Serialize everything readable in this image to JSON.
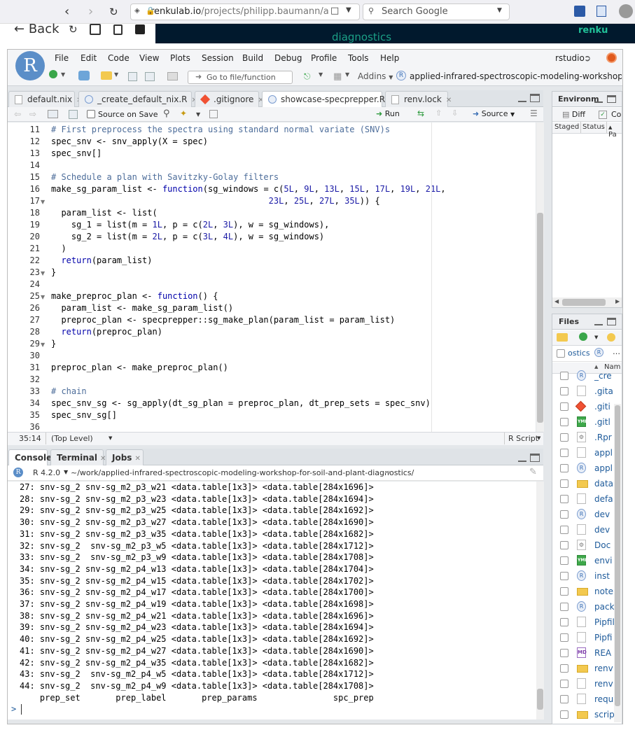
{
  "browser": {
    "url_host": "renkulab.io",
    "url_path": "/projects/philipp.baumann/a",
    "search_placeholder": "Search Google"
  },
  "renku": {
    "back_label": "Back",
    "title": "diagnostics",
    "logo": "renku"
  },
  "rstudio": {
    "menu": [
      "File",
      "Edit",
      "Code",
      "View",
      "Plots",
      "Session",
      "Build",
      "Debug",
      "Profile",
      "Tools",
      "Help"
    ],
    "user": "rstudio",
    "goto_placeholder": "Go to file/function",
    "addins_label": "Addins",
    "project_label": "applied-infrared-spectroscopic-modeling-workshop-for-soil-an"
  },
  "source": {
    "tabs": [
      {
        "label": "default.nix"
      },
      {
        "label": "_create_default_nix.R"
      },
      {
        "label": ".gitignore"
      },
      {
        "label": "showcase-specprepper.R"
      },
      {
        "label": "renv.lock"
      }
    ],
    "source_on_save": "Source on Save",
    "run_label": "Run",
    "source_label": "Source",
    "lines": [
      {
        "n": "11",
        "t": "# First preprocess the spectra using standard normal variate (SNV)s"
      },
      {
        "n": "12",
        "t": "spec_snv <- snv_apply(X = spec)"
      },
      {
        "n": "13",
        "t": "spec_snv[]"
      },
      {
        "n": "14",
        "t": ""
      },
      {
        "n": "15",
        "t": "# Schedule a plan with Savitzky-Golay filters"
      },
      {
        "n": "16",
        "t": "make_sg_param_list <- function(sg_windows = c(5L, 9L, 13L, 15L, 17L, 19L, 21L,"
      },
      {
        "n": "17",
        "t": "                                           23L, 25L, 27L, 35L)) {"
      },
      {
        "n": "18",
        "t": "  param_list <- list("
      },
      {
        "n": "19",
        "t": "    sg_1 = list(m = 1L, p = c(2L, 3L), w = sg_windows),"
      },
      {
        "n": "20",
        "t": "    sg_2 = list(m = 2L, p = c(3L, 4L), w = sg_windows)"
      },
      {
        "n": "21",
        "t": "  )"
      },
      {
        "n": "22",
        "t": "  return(param_list)"
      },
      {
        "n": "23",
        "t": "}"
      },
      {
        "n": "24",
        "t": ""
      },
      {
        "n": "25",
        "t": "make_preproc_plan <- function() {"
      },
      {
        "n": "26",
        "t": "  param_list <- make_sg_param_list()"
      },
      {
        "n": "27",
        "t": "  preproc_plan <- specprepper::sg_make_plan(param_list = param_list)"
      },
      {
        "n": "28",
        "t": "  return(preproc_plan)"
      },
      {
        "n": "29",
        "t": "}"
      },
      {
        "n": "30",
        "t": ""
      },
      {
        "n": "31",
        "t": "preproc_plan <- make_preproc_plan()"
      },
      {
        "n": "32",
        "t": ""
      },
      {
        "n": "33",
        "t": "# chain"
      },
      {
        "n": "34",
        "t": "spec_snv_sg <- sg_apply(dt_sg_plan = preproc_plan, dt_prep_sets = spec_snv)"
      },
      {
        "n": "35",
        "t": "spec_snv_sg[]"
      },
      {
        "n": "36",
        "t": ""
      }
    ],
    "cursor_pos": "35:14",
    "scope": "(Top Level)",
    "file_type": "R Script"
  },
  "console": {
    "tabs": [
      "Console",
      "Terminal",
      "Jobs"
    ],
    "r_version": "R 4.2.0",
    "path": "~/work/applied-infrared-spectroscopic-modeling-workshop-for-soil-and-plant-diagnostics/",
    "lines": [
      "27: snv-sg_2 snv-sg_m2_p3_w21 <data.table[1x3]> <data.table[284x1696]>",
      "28: snv-sg_2 snv-sg_m2_p3_w23 <data.table[1x3]> <data.table[284x1694]>",
      "29: snv-sg_2 snv-sg_m2_p3_w25 <data.table[1x3]> <data.table[284x1692]>",
      "30: snv-sg_2 snv-sg_m2_p3_w27 <data.table[1x3]> <data.table[284x1690]>",
      "31: snv-sg_2 snv-sg_m2_p3_w35 <data.table[1x3]> <data.table[284x1682]>",
      "32: snv-sg_2  snv-sg_m2_p3_w5 <data.table[1x3]> <data.table[284x1712]>",
      "33: snv-sg_2  snv-sg_m2_p3_w9 <data.table[1x3]> <data.table[284x1708]>",
      "34: snv-sg_2 snv-sg_m2_p4_w13 <data.table[1x3]> <data.table[284x1704]>",
      "35: snv-sg_2 snv-sg_m2_p4_w15 <data.table[1x3]> <data.table[284x1702]>",
      "36: snv-sg_2 snv-sg_m2_p4_w17 <data.table[1x3]> <data.table[284x1700]>",
      "37: snv-sg_2 snv-sg_m2_p4_w19 <data.table[1x3]> <data.table[284x1698]>",
      "38: snv-sg_2 snv-sg_m2_p4_w21 <data.table[1x3]> <data.table[284x1696]>",
      "39: snv-sg_2 snv-sg_m2_p4_w23 <data.table[1x3]> <data.table[284x1694]>",
      "40: snv-sg_2 snv-sg_m2_p4_w25 <data.table[1x3]> <data.table[284x1692]>",
      "41: snv-sg_2 snv-sg_m2_p4_w27 <data.table[1x3]> <data.table[284x1690]>",
      "42: snv-sg_2 snv-sg_m2_p4_w35 <data.table[1x3]> <data.table[284x1682]>",
      "43: snv-sg_2  snv-sg_m2_p4_w5 <data.table[1x3]> <data.table[284x1712]>",
      "44: snv-sg_2  snv-sg_m2_p4_w9 <data.table[1x3]> <data.table[284x1708]>",
      "    prep_set       prep_label       prep_params               spc_prep"
    ],
    "prompt": ">"
  },
  "env": {
    "title": "Environm",
    "diff_label": "Diff",
    "commit_label": "Co",
    "col_staged": "Staged",
    "col_status": "Status",
    "col_path": "Pa"
  },
  "files": {
    "title": "Files",
    "breadcrumb": "ostics",
    "col_name": "Nam",
    "items": [
      {
        "name": "_cre",
        "icon": "r"
      },
      {
        "name": ".gita",
        "icon": "file"
      },
      {
        "name": ".giti",
        "icon": "git"
      },
      {
        "name": ".gitl",
        "icon": "yml"
      },
      {
        "name": ".Rpr",
        "icon": "gear"
      },
      {
        "name": "appl",
        "icon": "file"
      },
      {
        "name": "appl",
        "icon": "r"
      },
      {
        "name": "data",
        "icon": "folder"
      },
      {
        "name": "defa",
        "icon": "file"
      },
      {
        "name": "dev",
        "icon": "r"
      },
      {
        "name": "dev",
        "icon": "file"
      },
      {
        "name": "Doc",
        "icon": "gear"
      },
      {
        "name": "envi",
        "icon": "yml"
      },
      {
        "name": "inst",
        "icon": "r"
      },
      {
        "name": "note",
        "icon": "folder"
      },
      {
        "name": "pack",
        "icon": "r"
      },
      {
        "name": "Pipfile",
        "icon": "file"
      },
      {
        "name": "Pipfi",
        "icon": "file"
      },
      {
        "name": "REA",
        "icon": "md"
      },
      {
        "name": "renv",
        "icon": "folder"
      },
      {
        "name": "renv",
        "icon": "file"
      },
      {
        "name": "requ",
        "icon": "file"
      },
      {
        "name": "scripts",
        "icon": "folder"
      }
    ]
  },
  "colors": {
    "comment": "#4d6d9a",
    "keyword": "#0000aa",
    "number": "#1a1aa6",
    "renku_dark": "#01192d",
    "renku_green": "#21c199"
  }
}
